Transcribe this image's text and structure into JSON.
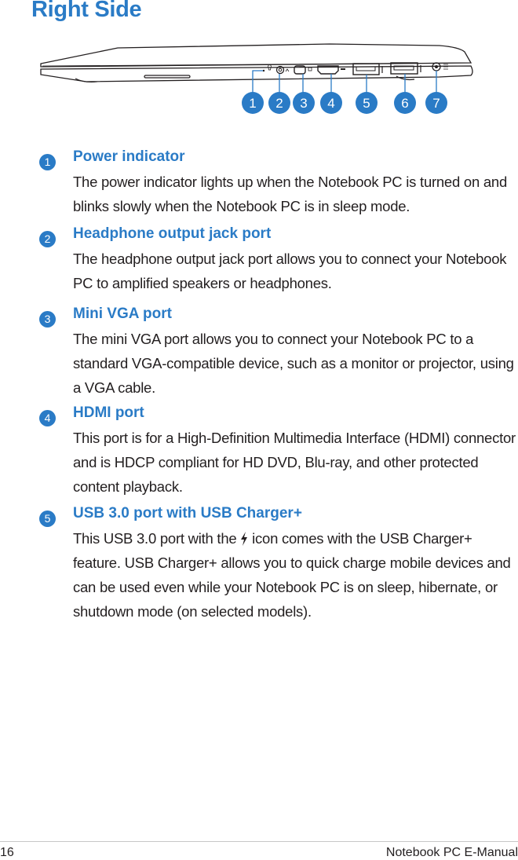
{
  "page": {
    "title": "Right Side",
    "accent_color": "#2a7bc6"
  },
  "diagram": {
    "callouts": [
      "1",
      "2",
      "3",
      "4",
      "5",
      "6",
      "7"
    ],
    "port_icons": [
      "power-indicator-icon",
      "headphone-icon",
      "mini-vga-icon",
      "hdmi-icon",
      "usb-charger-icon",
      "usb-icon",
      "dc-in-icon"
    ]
  },
  "sections": [
    {
      "number": "1",
      "title": "Power indicator",
      "body": "The power indicator lights up when the Notebook PC is turned on and blinks slowly when the Notebook PC is in sleep mode."
    },
    {
      "number": "2",
      "title": "Headphone output jack port",
      "body": "The headphone output jack port allows you to connect your Notebook PC to amplified speakers or headphones."
    },
    {
      "number": "3",
      "title": "Mini VGA port",
      "body": "The mini VGA port allows you to connect your Notebook PC to a standard VGA-compatible device, such as a monitor or projector, using a VGA cable."
    },
    {
      "number": "4",
      "title": "HDMI port",
      "body": "This port is for a High-Definition Multimedia Interface (HDMI) connector and is HDCP compliant for HD DVD, Blu-ray, and other protected content playback."
    },
    {
      "number": "5",
      "title": "USB 3.0 port with USB Charger+",
      "body_before_icon": "This USB 3.0 port with the ",
      "inline_icon": "lightning-bolt-icon",
      "body_after_icon": " icon comes with the USB Charger+ feature. USB Charger+ allows you to quick charge mobile devices and can be used even while your Notebook PC is on sleep, hibernate, or shutdown mode (on selected models)."
    }
  ],
  "footer": {
    "page_number": "16",
    "manual_name": "Notebook PC E-Manual"
  }
}
